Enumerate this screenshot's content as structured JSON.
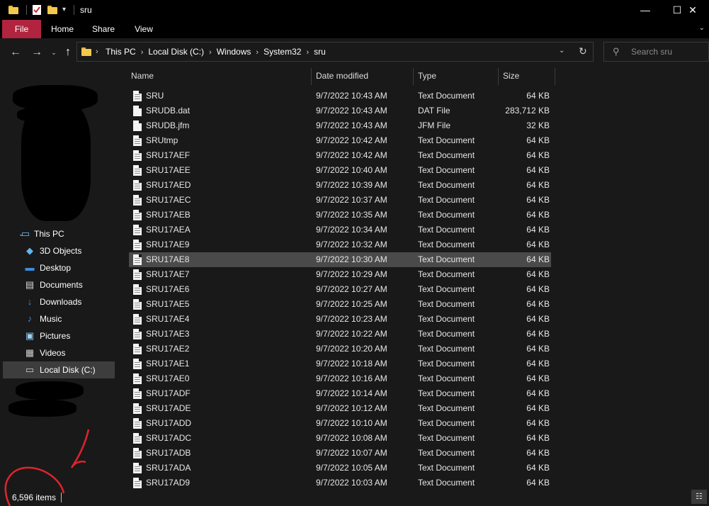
{
  "window": {
    "title": "sru",
    "minimize": "—",
    "maximize": "☐",
    "close": "✕"
  },
  "ribbon": {
    "tabs": [
      "File",
      "Home",
      "Share",
      "View"
    ],
    "chevron": "⌄"
  },
  "address": {
    "breadcrumbs": [
      "This PC",
      "Local Disk (C:)",
      "Windows",
      "System32",
      "sru"
    ],
    "separator": "›"
  },
  "search": {
    "placeholder": "Search sru",
    "value": ""
  },
  "nav": {
    "items": [
      {
        "label": "This PC",
        "icon": "computer-icon"
      },
      {
        "label": "3D Objects",
        "icon": "3d-objects-icon"
      },
      {
        "label": "Desktop",
        "icon": "desktop-icon"
      },
      {
        "label": "Documents",
        "icon": "documents-icon"
      },
      {
        "label": "Downloads",
        "icon": "downloads-icon"
      },
      {
        "label": "Music",
        "icon": "music-icon"
      },
      {
        "label": "Pictures",
        "icon": "pictures-icon"
      },
      {
        "label": "Videos",
        "icon": "videos-icon"
      },
      {
        "label": "Local Disk (C:)",
        "icon": "drive-icon",
        "selected": true
      }
    ]
  },
  "columns": {
    "name": "Name",
    "date": "Date modified",
    "type": "Type",
    "size": "Size"
  },
  "files": [
    {
      "name": "SRU",
      "date": "9/7/2022 10:43 AM",
      "type": "Text Document",
      "size": "64 KB"
    },
    {
      "name": "SRUDB.dat",
      "date": "9/7/2022 10:43 AM",
      "type": "DAT File",
      "size": "283,712 KB"
    },
    {
      "name": "SRUDB.jfm",
      "date": "9/7/2022 10:43 AM",
      "type": "JFM File",
      "size": "32 KB"
    },
    {
      "name": "SRUtmp",
      "date": "9/7/2022 10:42 AM",
      "type": "Text Document",
      "size": "64 KB"
    },
    {
      "name": "SRU17AEF",
      "date": "9/7/2022 10:42 AM",
      "type": "Text Document",
      "size": "64 KB"
    },
    {
      "name": "SRU17AEE",
      "date": "9/7/2022 10:40 AM",
      "type": "Text Document",
      "size": "64 KB"
    },
    {
      "name": "SRU17AED",
      "date": "9/7/2022 10:39 AM",
      "type": "Text Document",
      "size": "64 KB"
    },
    {
      "name": "SRU17AEC",
      "date": "9/7/2022 10:37 AM",
      "type": "Text Document",
      "size": "64 KB"
    },
    {
      "name": "SRU17AEB",
      "date": "9/7/2022 10:35 AM",
      "type": "Text Document",
      "size": "64 KB"
    },
    {
      "name": "SRU17AEA",
      "date": "9/7/2022 10:34 AM",
      "type": "Text Document",
      "size": "64 KB"
    },
    {
      "name": "SRU17AE9",
      "date": "9/7/2022 10:32 AM",
      "type": "Text Document",
      "size": "64 KB"
    },
    {
      "name": "SRU17AE8",
      "date": "9/7/2022 10:30 AM",
      "type": "Text Document",
      "size": "64 KB",
      "selected": true
    },
    {
      "name": "SRU17AE7",
      "date": "9/7/2022 10:29 AM",
      "type": "Text Document",
      "size": "64 KB"
    },
    {
      "name": "SRU17AE6",
      "date": "9/7/2022 10:27 AM",
      "type": "Text Document",
      "size": "64 KB"
    },
    {
      "name": "SRU17AE5",
      "date": "9/7/2022 10:25 AM",
      "type": "Text Document",
      "size": "64 KB"
    },
    {
      "name": "SRU17AE4",
      "date": "9/7/2022 10:23 AM",
      "type": "Text Document",
      "size": "64 KB"
    },
    {
      "name": "SRU17AE3",
      "date": "9/7/2022 10:22 AM",
      "type": "Text Document",
      "size": "64 KB"
    },
    {
      "name": "SRU17AE2",
      "date": "9/7/2022 10:20 AM",
      "type": "Text Document",
      "size": "64 KB"
    },
    {
      "name": "SRU17AE1",
      "date": "9/7/2022 10:18 AM",
      "type": "Text Document",
      "size": "64 KB"
    },
    {
      "name": "SRU17AE0",
      "date": "9/7/2022 10:16 AM",
      "type": "Text Document",
      "size": "64 KB"
    },
    {
      "name": "SRU17ADF",
      "date": "9/7/2022 10:14 AM",
      "type": "Text Document",
      "size": "64 KB"
    },
    {
      "name": "SRU17ADE",
      "date": "9/7/2022 10:12 AM",
      "type": "Text Document",
      "size": "64 KB"
    },
    {
      "name": "SRU17ADD",
      "date": "9/7/2022 10:10 AM",
      "type": "Text Document",
      "size": "64 KB"
    },
    {
      "name": "SRU17ADC",
      "date": "9/7/2022 10:08 AM",
      "type": "Text Document",
      "size": "64 KB"
    },
    {
      "name": "SRU17ADB",
      "date": "9/7/2022 10:07 AM",
      "type": "Text Document",
      "size": "64 KB"
    },
    {
      "name": "SRU17ADA",
      "date": "9/7/2022 10:05 AM",
      "type": "Text Document",
      "size": "64 KB"
    },
    {
      "name": "SRU17AD9",
      "date": "9/7/2022 10:03 AM",
      "type": "Text Document",
      "size": "64 KB"
    }
  ],
  "status": {
    "item_count": "6,596 items"
  },
  "colors": {
    "file_tab": "#b0243f",
    "background": "#191919",
    "selection": "#4a4a4a",
    "annotation": "#e0242c"
  }
}
